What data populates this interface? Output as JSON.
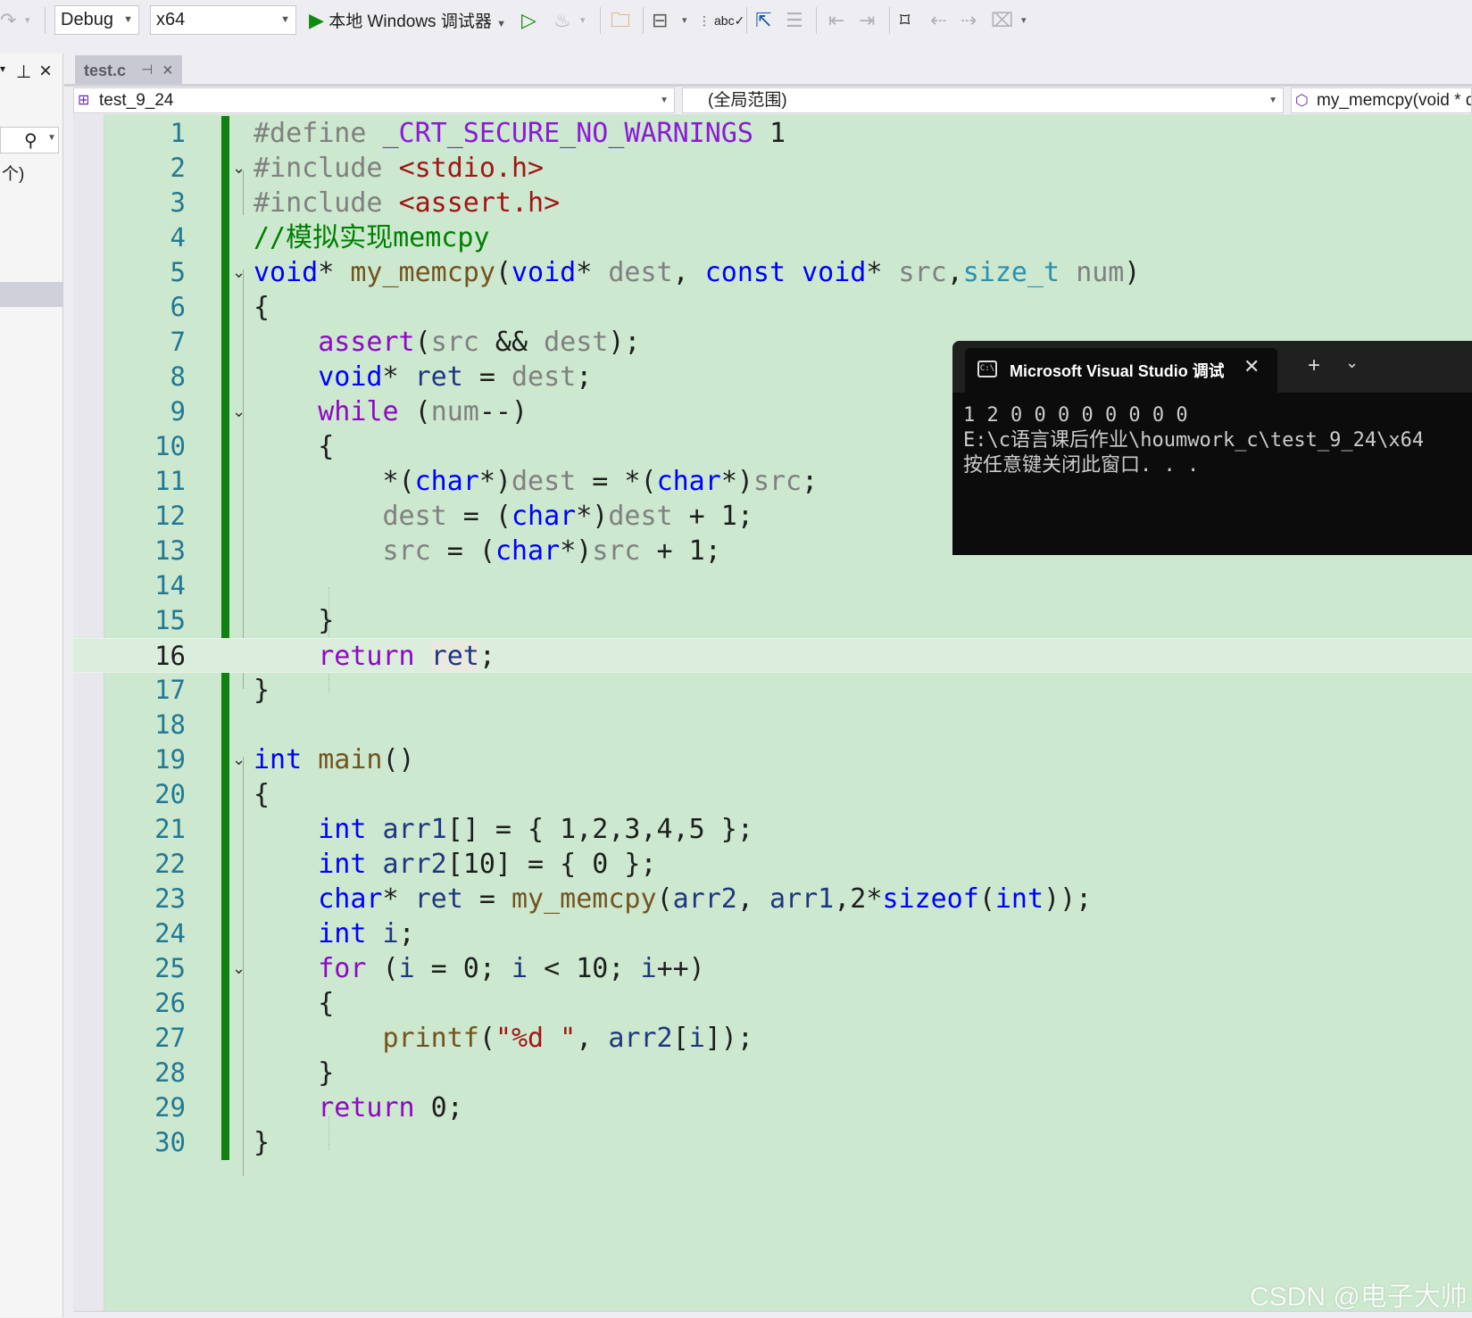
{
  "toolbar": {
    "config": "Debug",
    "platform": "x64",
    "run_label": "本地 Windows 调试器"
  },
  "tab": {
    "title": "test.c"
  },
  "navbar": {
    "project": "test_9_24",
    "scope": "(全局范围)",
    "member": "my_memcpy(void * d"
  },
  "left_panel": {
    "text": "个)"
  },
  "editor": {
    "current_line": 16,
    "lines": [
      {
        "n": "1"
      },
      {
        "n": "2"
      },
      {
        "n": "3"
      },
      {
        "n": "4"
      },
      {
        "n": "5"
      },
      {
        "n": "6"
      },
      {
        "n": "7"
      },
      {
        "n": "8"
      },
      {
        "n": "9"
      },
      {
        "n": "10"
      },
      {
        "n": "11"
      },
      {
        "n": "12"
      },
      {
        "n": "13"
      },
      {
        "n": "14"
      },
      {
        "n": "15"
      },
      {
        "n": "16"
      },
      {
        "n": "17"
      },
      {
        "n": "18"
      },
      {
        "n": "19"
      },
      {
        "n": "20"
      },
      {
        "n": "21"
      },
      {
        "n": "22"
      },
      {
        "n": "23"
      },
      {
        "n": "24"
      },
      {
        "n": "25"
      },
      {
        "n": "26"
      },
      {
        "n": "27"
      },
      {
        "n": "28"
      },
      {
        "n": "29"
      },
      {
        "n": "30"
      }
    ],
    "code": {
      "l1": [
        "#define ",
        "_CRT_SECURE_NO_WARNINGS",
        " 1"
      ],
      "l2": [
        "#include ",
        "<stdio.h>"
      ],
      "l3": [
        "#include ",
        "<assert.h>"
      ],
      "l4": [
        "//模拟实现memcpy"
      ],
      "l5": [
        "void",
        "* ",
        "my_memcpy",
        "(",
        "void",
        "* ",
        "dest",
        ", ",
        "const",
        " ",
        "void",
        "* ",
        "src",
        ",",
        "size_t",
        " ",
        "num",
        ")"
      ],
      "l6": [
        "{"
      ],
      "l7": [
        "    ",
        "assert",
        "(",
        "src",
        " && ",
        "dest",
        ");"
      ],
      "l8": [
        "    ",
        "void",
        "* ",
        "ret",
        " = ",
        "dest",
        ";"
      ],
      "l9": [
        "    ",
        "while",
        " (",
        "num",
        "--)"
      ],
      "l10": [
        "    {"
      ],
      "l11": [
        "        *(",
        "char",
        "*)",
        "dest",
        " = *(",
        "char",
        "*)",
        "src",
        ";"
      ],
      "l12": [
        "        ",
        "dest",
        " = (",
        "char",
        "*)",
        "dest",
        " + 1;"
      ],
      "l13": [
        "        ",
        "src",
        " = (",
        "char",
        "*)",
        "src",
        " + 1;"
      ],
      "l14": [
        ""
      ],
      "l15": [
        "    }"
      ],
      "l16": [
        "    ",
        "return",
        " ",
        "ret",
        ";"
      ],
      "l17": [
        "}"
      ],
      "l18": [
        ""
      ],
      "l19": [
        "int",
        " ",
        "main",
        "()"
      ],
      "l20": [
        "{"
      ],
      "l21": [
        "    ",
        "int",
        " ",
        "arr1",
        "[] = { 1,2,3,4,5 };"
      ],
      "l22": [
        "    ",
        "int",
        " ",
        "arr2",
        "[10] = { 0 };"
      ],
      "l23": [
        "    ",
        "char",
        "* ",
        "ret",
        " = ",
        "my_memcpy",
        "(",
        "arr2",
        ", ",
        "arr1",
        ",2*",
        "sizeof",
        "(",
        "int",
        "));"
      ],
      "l24": [
        "    ",
        "int",
        " ",
        "i",
        ";"
      ],
      "l25": [
        "    ",
        "for",
        " (",
        "i",
        " = 0; ",
        "i",
        " < 10; ",
        "i",
        "++)"
      ],
      "l26": [
        "    {"
      ],
      "l27": [
        "        ",
        "printf",
        "(",
        "\"%d \"",
        ", ",
        "arr2",
        "[",
        "i",
        "]);"
      ],
      "l28": [
        "    }"
      ],
      "l29": [
        "    ",
        "return",
        " 0;"
      ],
      "l30": [
        "}"
      ]
    }
  },
  "console": {
    "title": "Microsoft Visual Studio 调试控制台",
    "plus": "+",
    "line1": "1 2 0 0 0 0 0 0 0 0",
    "line2": "E:\\c语言课后作业\\houmwork_c\\test_9_24\\x64",
    "line3": "按任意键关闭此窗口. . ."
  },
  "watermark": "CSDN @电子大帅",
  "colors": {
    "editor_bg": "#cce8cf",
    "change_bar": "#108010",
    "keyword": "#0000ff",
    "control": "#8f08c4",
    "comment": "#008000",
    "string": "#a31515"
  }
}
